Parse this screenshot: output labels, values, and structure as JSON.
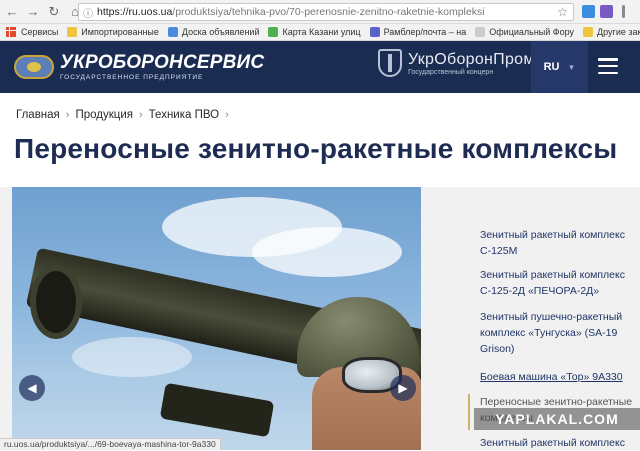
{
  "browser": {
    "url_host": "https://ru.uos.ua",
    "url_path": "/produktsiya/tehnika-pvo/70-perenosnie-zenitno-raketnie-kompleksi",
    "status_url": "ru.uos.ua/produktsiya/.../69-boevaya-mashina-tor-9a330"
  },
  "bookmarks": [
    {
      "label": "Сервисы",
      "color": "#e24b2c"
    },
    {
      "label": "Импортированные",
      "color": "#f0c43c"
    },
    {
      "label": "Доска объявлений",
      "color": "#4a8be0"
    },
    {
      "label": "Карта Казани улиц",
      "color": "#4caf50"
    },
    {
      "label": "Рамблер/почта – на",
      "color": "#5a64c8"
    },
    {
      "label": "Официальный Фору",
      "color": "#cccccc"
    },
    {
      "label": "Другие заклад",
      "color": "#f0c43c"
    }
  ],
  "header": {
    "logo_ubs_title": "УКРОБОРОНСЕРВИС",
    "logo_ubs_sub": "ГОСУДАРСТВЕННОЕ ПРЕДПРИЯТИЕ",
    "logo_uop_title": "УкрОборонПром",
    "logo_uop_sub": "Государственный концерн",
    "lang": "RU"
  },
  "breadcrumb": [
    "Главная",
    "Продукция",
    "Техника ПВО"
  ],
  "page_title": "Переносные зенитно-ракетные комплексы",
  "side_menu": [
    {
      "label": "Зенитный ракетный комплекс С-125М"
    },
    {
      "label": "Зенитный ракетный комплекс С-125-2Д «ПЕЧОРА-2Д»"
    },
    {
      "label": "Зенитный пушечно-ракетный комплекс «Тунгуска» (SA-19 Grison)"
    },
    {
      "label": "Боевая машина «Тор» 9А330"
    },
    {
      "label": "Переносные зенитно-ракетные комплексы"
    },
    {
      "label": "Зенитный ракетный комплекс"
    }
  ],
  "watermark": "YAPLAKAL.COM",
  "colors": {
    "header_bg": "#1b2c52",
    "title": "#1e2b52",
    "link": "#1f3566"
  }
}
